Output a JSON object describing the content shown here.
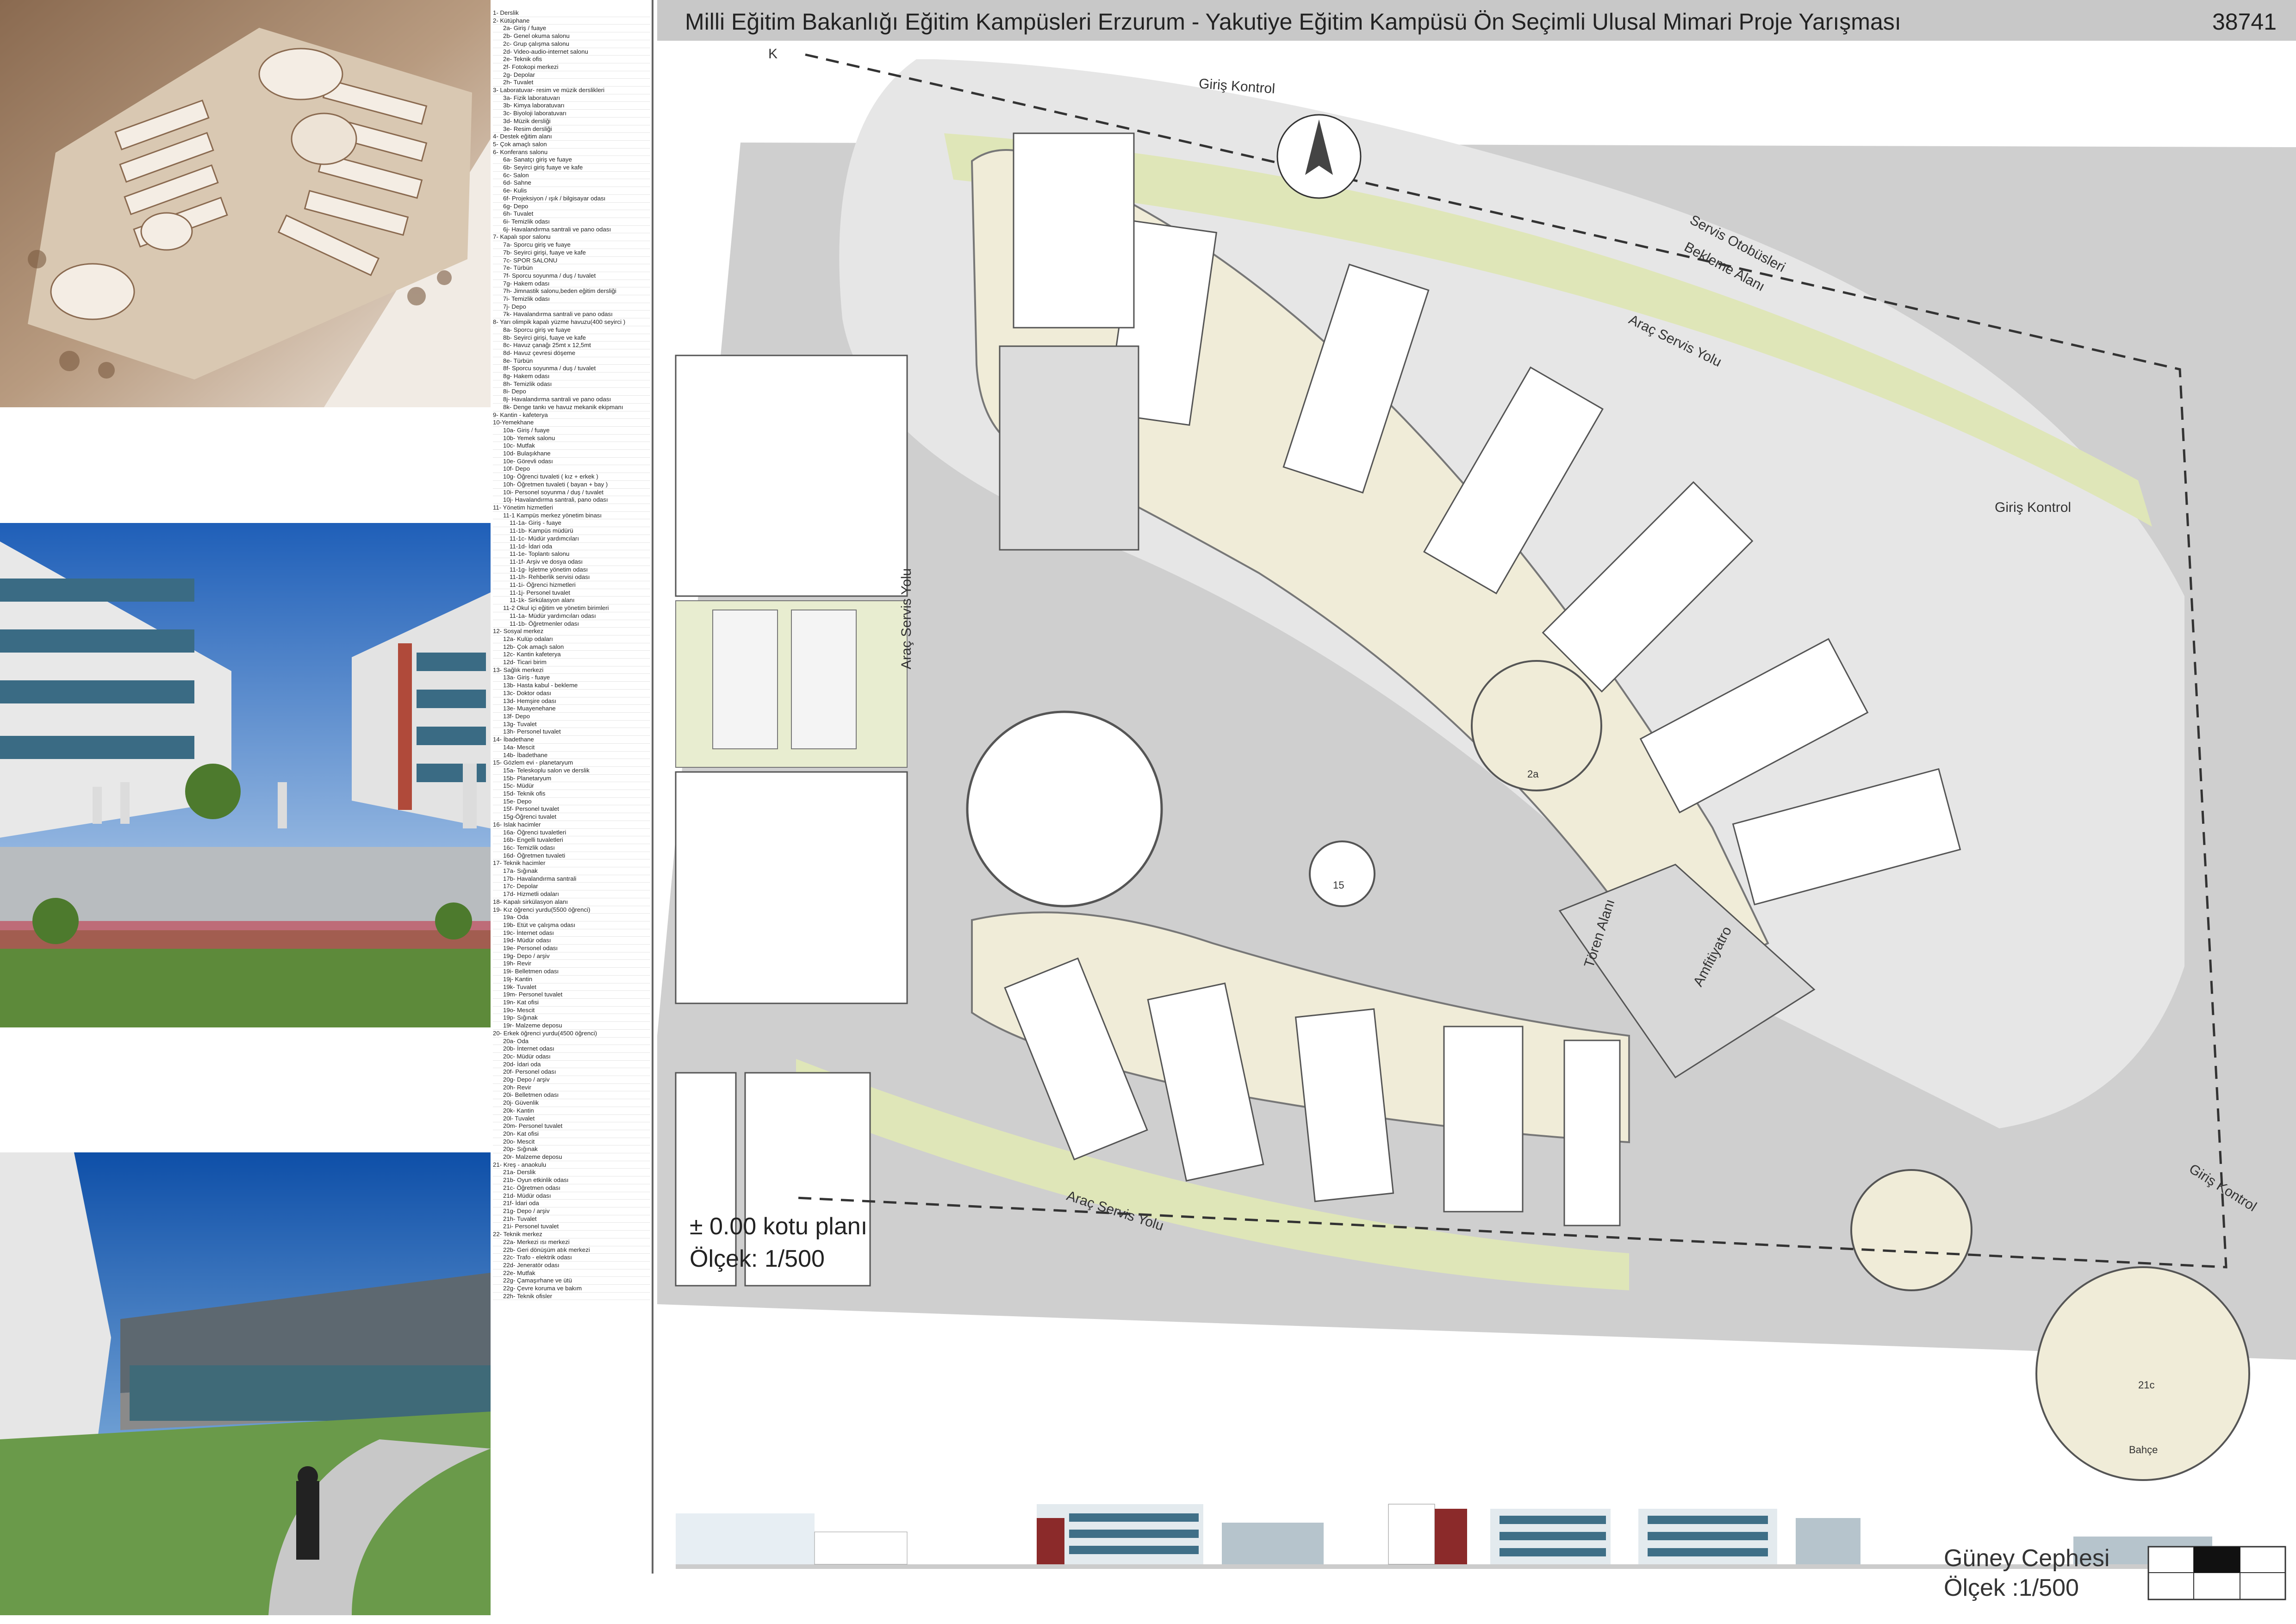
{
  "header": {
    "title": "Milli Eğitim Bakanlığı Eğitim Kampüsleri  Erzurum - Yakutiye Eğitim Kampüsü Ön Seçimli Ulusal Mimari Proje Yarışması",
    "project_no": "38741"
  },
  "plan": {
    "title": "± 0.00 kotu planı",
    "scale": "Ölçek: 1/500",
    "north": "K",
    "labels": {
      "giris_kontrol_1": "Giriş Kontrol",
      "giris_kontrol_2": "Giriş Kontrol",
      "giris_kontrol_3": "Giriş Kontrol",
      "servis_otobusleri": "Servis Otobüsleri",
      "bekleme_alani": "Bekleme Alanı",
      "arac_servis_1": "Araç Servis Yolu",
      "arac_servis_2": "Araç Servis Yolu",
      "arac_servis_3": "Araç Servis Yolu",
      "toren_alani": "Tören Alanı",
      "amfitiyatro": "Amfitiyatro",
      "bahce": "Bahçe",
      "n15": "15",
      "n21c": "21c",
      "n2a": "2a"
    }
  },
  "elevation": {
    "title": "Güney Cephesi",
    "scale": "Ölçek :1/500"
  },
  "legend": [
    {
      "t": "1- Derslik",
      "l": 0
    },
    {
      "t": "2- Kütüphane",
      "l": 0
    },
    {
      "t": "2a- Giriş / fuaye",
      "l": 1
    },
    {
      "t": "2b- Genel okuma salonu",
      "l": 1
    },
    {
      "t": "2c- Grup çalışma salonu",
      "l": 1
    },
    {
      "t": "2d- Video-audio-internet salonu",
      "l": 1
    },
    {
      "t": "2e- Teknik ofis",
      "l": 1
    },
    {
      "t": "2f- Fotokopi merkezi",
      "l": 1
    },
    {
      "t": "2g- Depolar",
      "l": 1
    },
    {
      "t": "2h- Tuvalet",
      "l": 1
    },
    {
      "t": "3- Laboratuvar- resim ve müzik derslikleri",
      "l": 0
    },
    {
      "t": "3a- Fizik laboratuvarı",
      "l": 1
    },
    {
      "t": "3b- Kimya laboratuvarı",
      "l": 1
    },
    {
      "t": "3c- Biyoloji laboratuvarı",
      "l": 1
    },
    {
      "t": "3d- Müzik dersliği",
      "l": 1
    },
    {
      "t": "3e- Resim dersliği",
      "l": 1
    },
    {
      "t": "4- Destek eğitim alanı",
      "l": 0
    },
    {
      "t": "5- Çok amaçlı salon",
      "l": 0
    },
    {
      "t": "6- Konferans salonu",
      "l": 0
    },
    {
      "t": "6a- Sanatçı giriş ve fuaye",
      "l": 1
    },
    {
      "t": "6b- Seyirci giriş fuaye ve kafe",
      "l": 1
    },
    {
      "t": "6c- Salon",
      "l": 1
    },
    {
      "t": "6d- Sahne",
      "l": 1
    },
    {
      "t": "6e- Kulis",
      "l": 1
    },
    {
      "t": "6f- Projeksiyon / ışık / bilgisayar odası",
      "l": 1
    },
    {
      "t": "6g- Depo",
      "l": 1
    },
    {
      "t": "6h- Tuvalet",
      "l": 1
    },
    {
      "t": "6i- Temizlik odası",
      "l": 1
    },
    {
      "t": "6j- Havalandırma santrali ve pano odası",
      "l": 1
    },
    {
      "t": "7- Kapalı spor salonu",
      "l": 0
    },
    {
      "t": "7a- Sporcu giriş ve fuaye",
      "l": 1
    },
    {
      "t": "7b- Seyirci girişi, fuaye ve kafe",
      "l": 1
    },
    {
      "t": "7c- SPOR SALONU",
      "l": 1
    },
    {
      "t": "7e- Türbün",
      "l": 1
    },
    {
      "t": "7f- Sporcu soyunma / duş / tuvalet",
      "l": 1
    },
    {
      "t": "7g- Hakem odası",
      "l": 1
    },
    {
      "t": "7h- Jimnastik salonu,beden eğitim dersliği",
      "l": 1
    },
    {
      "t": "7i- Temizlik odası",
      "l": 1
    },
    {
      "t": "7j- Depo",
      "l": 1
    },
    {
      "t": "7k- Havalandırma santrali ve pano odası",
      "l": 1
    },
    {
      "t": "8- Yarı olimpik kapalı yüzme havuzu(400 seyirci )",
      "l": 0
    },
    {
      "t": "8a- Sporcu giriş ve fuaye",
      "l": 1
    },
    {
      "t": "8b- Seyirci girişi, fuaye ve kafe",
      "l": 1
    },
    {
      "t": "8c- Havuz çanağı 25mt x 12,5mt",
      "l": 1
    },
    {
      "t": "8d- Havuz çevresi döşeme",
      "l": 1
    },
    {
      "t": "8e- Türbün",
      "l": 1
    },
    {
      "t": "8f- Sporcu soyunma / duş / tuvalet",
      "l": 1
    },
    {
      "t": "8g- Hakem odası",
      "l": 1
    },
    {
      "t": "8h- Temizlik odası",
      "l": 1
    },
    {
      "t": "8i- Depo",
      "l": 1
    },
    {
      "t": "8j- Havalandırma santrali ve pano odası",
      "l": 1
    },
    {
      "t": "8k- Denge tankı ve havuz mekanik ekipmanı",
      "l": 1
    },
    {
      "t": "9- Kantin - kafeterya",
      "l": 0
    },
    {
      "t": "10-Yemekhane",
      "l": 0
    },
    {
      "t": "10a- Giriş / fuaye",
      "l": 1
    },
    {
      "t": "10b- Yemek salonu",
      "l": 1
    },
    {
      "t": "10c- Mutfak",
      "l": 1
    },
    {
      "t": "10d- Bulaşıkhane",
      "l": 1
    },
    {
      "t": "10e- Görevli odası",
      "l": 1
    },
    {
      "t": "10f- Depo",
      "l": 1
    },
    {
      "t": "10g- Öğrenci tuvaleti ( kız + erkek )",
      "l": 1
    },
    {
      "t": "10h- Öğretmen tuvaleti ( bayan + bay )",
      "l": 1
    },
    {
      "t": "10i- Personel soyunma / duş / tuvalet",
      "l": 1
    },
    {
      "t": "10j- Havalandırma santrali, pano odası",
      "l": 1
    },
    {
      "t": "11- Yönetim hizmetleri",
      "l": 0
    },
    {
      "t": "11-1 Kampüs merkez yönetim binası",
      "l": 1
    },
    {
      "t": "11-1a- Giriş - fuaye",
      "l": 2
    },
    {
      "t": "11-1b- Kampüs müdürü",
      "l": 2
    },
    {
      "t": "11-1c- Müdür yardımcıları",
      "l": 2
    },
    {
      "t": "11-1d- İdari oda",
      "l": 2
    },
    {
      "t": "11-1e- Toplantı salonu",
      "l": 2
    },
    {
      "t": "11-1f- Arşiv ve dosya odası",
      "l": 2
    },
    {
      "t": "11-1g- İşletme yönetim odası",
      "l": 2
    },
    {
      "t": "11-1h- Rehberlik servisi odası",
      "l": 2
    },
    {
      "t": "11-1i- Öğrenci hizmetleri",
      "l": 2
    },
    {
      "t": "11-1j- Personel tuvalet",
      "l": 2
    },
    {
      "t": "11-1k- Sirkülasyon alanı",
      "l": 2
    },
    {
      "t": "11-2 Okul içi eğitim ve yönetim birimleri",
      "l": 1
    },
    {
      "t": "11-1a- Müdür yardımcıları odası",
      "l": 2
    },
    {
      "t": "11-1b- Öğretmenler odası",
      "l": 2
    },
    {
      "t": "12- Sosyal merkez",
      "l": 0
    },
    {
      "t": "12a- Kulüp odaları",
      "l": 1
    },
    {
      "t": "12b- Çok amaçlı salon",
      "l": 1
    },
    {
      "t": "12c- Kantin kafeterya",
      "l": 1
    },
    {
      "t": "12d- Ticari birim",
      "l": 1
    },
    {
      "t": "13- Sağlık merkezi",
      "l": 0
    },
    {
      "t": "13a- Giriş - fuaye",
      "l": 1
    },
    {
      "t": "13b- Hasta kabul - bekleme",
      "l": 1
    },
    {
      "t": "13c- Doktor odası",
      "l": 1
    },
    {
      "t": "13d- Hemşire odası",
      "l": 1
    },
    {
      "t": "13e- Muayenehane",
      "l": 1
    },
    {
      "t": "13f- Depo",
      "l": 1
    },
    {
      "t": "13g- Tuvalet",
      "l": 1
    },
    {
      "t": "13h- Personel tuvalet",
      "l": 1
    },
    {
      "t": "14- İbadethane",
      "l": 0
    },
    {
      "t": "14a- Mescit",
      "l": 1
    },
    {
      "t": "14b- İbadethane",
      "l": 1
    },
    {
      "t": "15- Gözlem evi - planetaryum",
      "l": 0
    },
    {
      "t": "15a- Teleskoplu salon ve derslik",
      "l": 1
    },
    {
      "t": "15b- Planetaryum",
      "l": 1
    },
    {
      "t": "15c- Müdür",
      "l": 1
    },
    {
      "t": "15d- Teknik ofis",
      "l": 1
    },
    {
      "t": "15e- Depo",
      "l": 1
    },
    {
      "t": "15f- Personel tuvalet",
      "l": 1
    },
    {
      "t": "15g-Öğrenci tuvalet",
      "l": 1
    },
    {
      "t": "16- Islak hacimler",
      "l": 0
    },
    {
      "t": "16a- Öğrenci tuvaletleri",
      "l": 1
    },
    {
      "t": "16b- Engelli tuvaletleri",
      "l": 1
    },
    {
      "t": "16c- Temizlik odası",
      "l": 1
    },
    {
      "t": "16d- Öğretmen tuvaleti",
      "l": 1
    },
    {
      "t": "17- Teknik hacimler",
      "l": 0
    },
    {
      "t": "17a- Sığınak",
      "l": 1
    },
    {
      "t": "17b- Havalandırma santrali",
      "l": 1
    },
    {
      "t": "17c- Depolar",
      "l": 1
    },
    {
      "t": "17d- Hizmetli odaları",
      "l": 1
    },
    {
      "t": "18- Kapalı sirkülasyon alanı",
      "l": 0
    },
    {
      "t": "19- Kız öğrenci yurdu(5500 öğrenci)",
      "l": 0
    },
    {
      "t": "19a- Oda",
      "l": 1
    },
    {
      "t": "19b- Etüt ve çalışma odası",
      "l": 1
    },
    {
      "t": "19c- İnternet odası",
      "l": 1
    },
    {
      "t": "19d- Müdür odası",
      "l": 1
    },
    {
      "t": "19e- Personel odası",
      "l": 1
    },
    {
      "t": "19g- Depo / arşiv",
      "l": 1
    },
    {
      "t": "19h- Revir",
      "l": 1
    },
    {
      "t": "19i- Belletmen odası",
      "l": 1
    },
    {
      "t": "19j- Kantin",
      "l": 1
    },
    {
      "t": "19k- Tuvalet",
      "l": 1
    },
    {
      "t": "19m- Personel tuvalet",
      "l": 1
    },
    {
      "t": "19n- Kat ofisi",
      "l": 1
    },
    {
      "t": "19o- Mescit",
      "l": 1
    },
    {
      "t": "19p- Sığınak",
      "l": 1
    },
    {
      "t": "19r- Malzeme deposu",
      "l": 1
    },
    {
      "t": "20- Erkek öğrenci yurdu(4500 öğrenci)",
      "l": 0
    },
    {
      "t": "20a- Oda",
      "l": 1
    },
    {
      "t": "20b- İnternet odası",
      "l": 1
    },
    {
      "t": "20c- Müdür odası",
      "l": 1
    },
    {
      "t": "20d- İdari oda",
      "l": 1
    },
    {
      "t": "20f- Personel odası",
      "l": 1
    },
    {
      "t": "20g- Depo / arşiv",
      "l": 1
    },
    {
      "t": "20h- Revir",
      "l": 1
    },
    {
      "t": "20i- Belletmen odası",
      "l": 1
    },
    {
      "t": "20j- Güvenlik",
      "l": 1
    },
    {
      "t": "20k- Kantin",
      "l": 1
    },
    {
      "t": "20l- Tuvalet",
      "l": 1
    },
    {
      "t": "20m- Personel tuvalet",
      "l": 1
    },
    {
      "t": "20n- Kat ofisi",
      "l": 1
    },
    {
      "t": "20o- Mescit",
      "l": 1
    },
    {
      "t": "20p- Sığınak",
      "l": 1
    },
    {
      "t": "20r- Malzeme deposu",
      "l": 1
    },
    {
      "t": "21- Kreş - anaokulu",
      "l": 0
    },
    {
      "t": "21a- Derslik",
      "l": 1
    },
    {
      "t": "21b- Oyun etkinlik odası",
      "l": 1
    },
    {
      "t": "21c- Öğretmen odası",
      "l": 1
    },
    {
      "t": "21d- Müdür odası",
      "l": 1
    },
    {
      "t": "21f- İdari oda",
      "l": 1
    },
    {
      "t": "21g- Depo / arşiv",
      "l": 1
    },
    {
      "t": "21h- Tuvalet",
      "l": 1
    },
    {
      "t": "21i- Personel tuvalet",
      "l": 1
    },
    {
      "t": "22- Teknik merkez",
      "l": 0
    },
    {
      "t": "22a- Merkezi ısı merkezi",
      "l": 1
    },
    {
      "t": "22b- Geri dönüşüm atık merkezi",
      "l": 1
    },
    {
      "t": "22c- Trafo - elektrik odası",
      "l": 1
    },
    {
      "t": "22d- Jeneratör odası",
      "l": 1
    },
    {
      "t": "22e- Mutfak",
      "l": 1
    },
    {
      "t": "22g- Çamaşırhane ve ütü",
      "l": 1
    },
    {
      "t": "22g- Çevre koruma ve bakım",
      "l": 1
    },
    {
      "t": "22h- Teknik ofisler",
      "l": 1
    }
  ]
}
